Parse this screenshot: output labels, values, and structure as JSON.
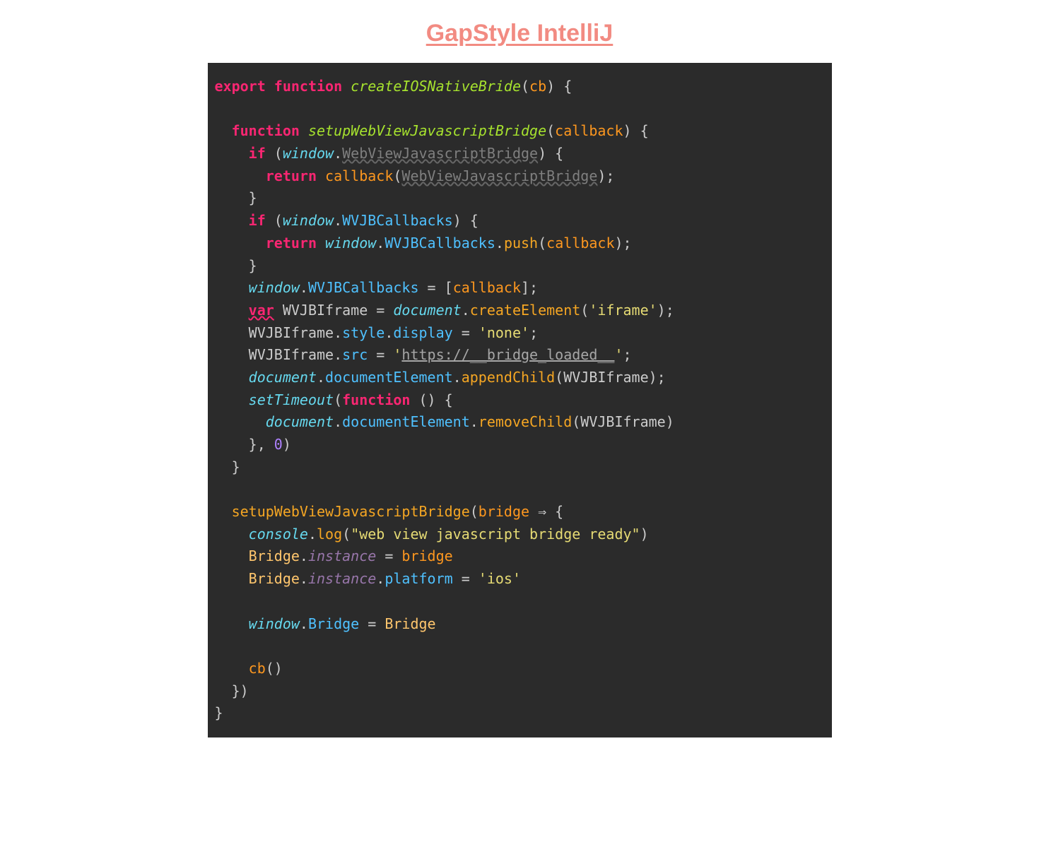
{
  "title": "GapStyle IntelliJ",
  "colors": {
    "title": "#f28b82",
    "editor_bg": "#2b2b2b",
    "keyword": "#f92672",
    "function_decl": "#a6e22e",
    "param": "#fd971f",
    "builtin_italic": "#66d9ef",
    "property_blue": "#4fc1ff",
    "method_orange": "#f5a623",
    "string": "#e6db74",
    "number": "#ae81ff",
    "bridge_class": "#ffc66d",
    "instance_purple": "#9876aa"
  },
  "code": {
    "tokens": [
      [
        {
          "t": "export ",
          "c": "kw-red"
        },
        {
          "t": "function ",
          "c": "kw-red"
        },
        {
          "t": "createIOSNativeBride",
          "c": "fn-green"
        },
        {
          "t": "(",
          "c": "punct"
        },
        {
          "t": "cb",
          "c": "param"
        },
        {
          "t": ") {",
          "c": "punct"
        }
      ],
      [],
      [
        {
          "t": "  ",
          "c": ""
        },
        {
          "t": "function ",
          "c": "kw-red"
        },
        {
          "t": "setupWebViewJavascriptBridge",
          "c": "fn-green"
        },
        {
          "t": "(",
          "c": "punct"
        },
        {
          "t": "callback",
          "c": "param"
        },
        {
          "t": ") {",
          "c": "punct"
        }
      ],
      [
        {
          "t": "    ",
          "c": ""
        },
        {
          "t": "if ",
          "c": "kw-red"
        },
        {
          "t": "(",
          "c": "punct"
        },
        {
          "t": "window",
          "c": "obj-it"
        },
        {
          "t": ".",
          "c": "punct"
        },
        {
          "t": "WebViewJavascriptBridge",
          "c": "gray-prop"
        },
        {
          "t": ") {",
          "c": "punct"
        }
      ],
      [
        {
          "t": "      ",
          "c": ""
        },
        {
          "t": "return ",
          "c": "kw-red"
        },
        {
          "t": "callback",
          "c": "param"
        },
        {
          "t": "(",
          "c": "punct"
        },
        {
          "t": "WebViewJavascriptBridge",
          "c": "gray-prop"
        },
        {
          "t": ");",
          "c": "punct"
        }
      ],
      [
        {
          "t": "    }",
          "c": "punct"
        }
      ],
      [
        {
          "t": "    ",
          "c": ""
        },
        {
          "t": "if ",
          "c": "kw-red"
        },
        {
          "t": "(",
          "c": "punct"
        },
        {
          "t": "window",
          "c": "obj-it"
        },
        {
          "t": ".",
          "c": "punct"
        },
        {
          "t": "WVJBCallbacks",
          "c": "mem-blue"
        },
        {
          "t": ") {",
          "c": "punct"
        }
      ],
      [
        {
          "t": "      ",
          "c": ""
        },
        {
          "t": "return ",
          "c": "kw-red"
        },
        {
          "t": "window",
          "c": "obj-it"
        },
        {
          "t": ".",
          "c": "punct"
        },
        {
          "t": "WVJBCallbacks",
          "c": "mem-blue"
        },
        {
          "t": ".",
          "c": "punct"
        },
        {
          "t": "push",
          "c": "method"
        },
        {
          "t": "(",
          "c": "punct"
        },
        {
          "t": "callback",
          "c": "param"
        },
        {
          "t": ");",
          "c": "punct"
        }
      ],
      [
        {
          "t": "    }",
          "c": "punct"
        }
      ],
      [
        {
          "t": "    ",
          "c": ""
        },
        {
          "t": "window",
          "c": "obj-it"
        },
        {
          "t": ".",
          "c": "punct"
        },
        {
          "t": "WVJBCallbacks",
          "c": "mem-blue"
        },
        {
          "t": " = [",
          "c": "punct"
        },
        {
          "t": "callback",
          "c": "param"
        },
        {
          "t": "];",
          "c": "punct"
        }
      ],
      [
        {
          "t": "    ",
          "c": ""
        },
        {
          "t": "var",
          "c": "var-und"
        },
        {
          "t": " WVJBIframe = ",
          "c": "ident"
        },
        {
          "t": "document",
          "c": "obj-it"
        },
        {
          "t": ".",
          "c": "punct"
        },
        {
          "t": "createElement",
          "c": "method"
        },
        {
          "t": "(",
          "c": "punct"
        },
        {
          "t": "'iframe'",
          "c": "str"
        },
        {
          "t": ");",
          "c": "punct"
        }
      ],
      [
        {
          "t": "    WVJBIframe.",
          "c": "ident"
        },
        {
          "t": "style",
          "c": "mem-blue"
        },
        {
          "t": ".",
          "c": "punct"
        },
        {
          "t": "display",
          "c": "mem-blue"
        },
        {
          "t": " = ",
          "c": "punct"
        },
        {
          "t": "'none'",
          "c": "str"
        },
        {
          "t": ";",
          "c": "punct"
        }
      ],
      [
        {
          "t": "    WVJBIframe.",
          "c": "ident"
        },
        {
          "t": "src",
          "c": "mem-blue"
        },
        {
          "t": " = ",
          "c": "punct"
        },
        {
          "t": "'",
          "c": "str"
        },
        {
          "t": "https://__bridge_loaded__",
          "c": "str-und"
        },
        {
          "t": "'",
          "c": "str"
        },
        {
          "t": ";",
          "c": "punct"
        }
      ],
      [
        {
          "t": "    ",
          "c": ""
        },
        {
          "t": "document",
          "c": "obj-it"
        },
        {
          "t": ".",
          "c": "punct"
        },
        {
          "t": "documentElement",
          "c": "mem-blue"
        },
        {
          "t": ".",
          "c": "punct"
        },
        {
          "t": "appendChild",
          "c": "method"
        },
        {
          "t": "(WVJBIframe);",
          "c": "punct"
        }
      ],
      [
        {
          "t": "    ",
          "c": ""
        },
        {
          "t": "setTimeout",
          "c": "obj-it"
        },
        {
          "t": "(",
          "c": "punct"
        },
        {
          "t": "function ",
          "c": "kw-red"
        },
        {
          "t": "() {",
          "c": "punct"
        }
      ],
      [
        {
          "t": "      ",
          "c": ""
        },
        {
          "t": "document",
          "c": "obj-it"
        },
        {
          "t": ".",
          "c": "punct"
        },
        {
          "t": "documentElement",
          "c": "mem-blue"
        },
        {
          "t": ".",
          "c": "punct"
        },
        {
          "t": "removeChild",
          "c": "method"
        },
        {
          "t": "(WVJBIframe)",
          "c": "punct"
        }
      ],
      [
        {
          "t": "    }, ",
          "c": "punct"
        },
        {
          "t": "0",
          "c": "num"
        },
        {
          "t": ")",
          "c": "punct"
        }
      ],
      [
        {
          "t": "  }",
          "c": "punct"
        }
      ],
      [],
      [
        {
          "t": "  ",
          "c": ""
        },
        {
          "t": "setupWebViewJavascriptBridge",
          "c": "method"
        },
        {
          "t": "(",
          "c": "punct"
        },
        {
          "t": "bridge",
          "c": "param"
        },
        {
          "t": " ",
          "c": ""
        },
        {
          "t": "⇒",
          "c": "arrow"
        },
        {
          "t": " {",
          "c": "punct"
        }
      ],
      [
        {
          "t": "    ",
          "c": ""
        },
        {
          "t": "console",
          "c": "obj-it"
        },
        {
          "t": ".",
          "c": "punct"
        },
        {
          "t": "log",
          "c": "method"
        },
        {
          "t": "(",
          "c": "punct"
        },
        {
          "t": "\"web view javascript bridge ready\"",
          "c": "str"
        },
        {
          "t": ")",
          "c": "punct"
        }
      ],
      [
        {
          "t": "    ",
          "c": ""
        },
        {
          "t": "Bridge",
          "c": "bridge-cl"
        },
        {
          "t": ".",
          "c": "punct"
        },
        {
          "t": "instance",
          "c": "instance-it"
        },
        {
          "t": " = ",
          "c": "punct"
        },
        {
          "t": "bridge",
          "c": "param"
        }
      ],
      [
        {
          "t": "    ",
          "c": ""
        },
        {
          "t": "Bridge",
          "c": "bridge-cl"
        },
        {
          "t": ".",
          "c": "punct"
        },
        {
          "t": "instance",
          "c": "instance-it"
        },
        {
          "t": ".",
          "c": "punct"
        },
        {
          "t": "platform",
          "c": "mem-blue"
        },
        {
          "t": " = ",
          "c": "punct"
        },
        {
          "t": "'ios'",
          "c": "str"
        }
      ],
      [],
      [
        {
          "t": "    ",
          "c": ""
        },
        {
          "t": "window",
          "c": "obj-it"
        },
        {
          "t": ".",
          "c": "punct"
        },
        {
          "t": "Bridge",
          "c": "mem-blue"
        },
        {
          "t": " = ",
          "c": "punct"
        },
        {
          "t": "Bridge",
          "c": "bridge-cl"
        }
      ],
      [],
      [
        {
          "t": "    ",
          "c": ""
        },
        {
          "t": "cb",
          "c": "param"
        },
        {
          "t": "()",
          "c": "punct"
        }
      ],
      [
        {
          "t": "  })",
          "c": "punct"
        }
      ],
      [
        {
          "t": "}",
          "c": "punct"
        }
      ]
    ]
  }
}
